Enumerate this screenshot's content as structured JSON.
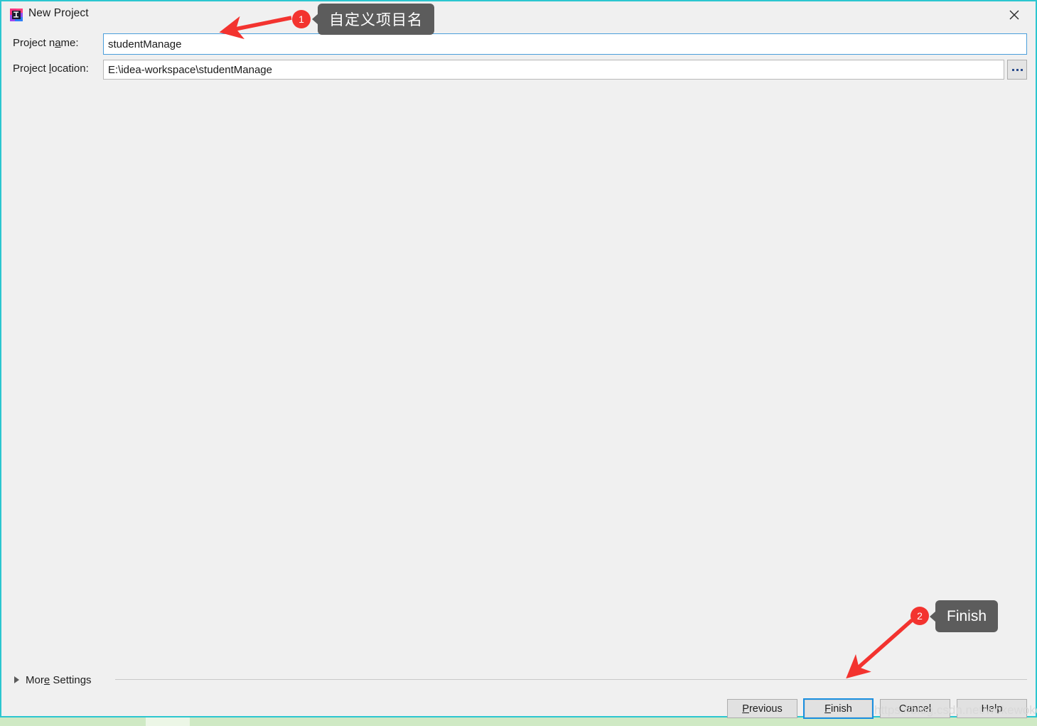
{
  "window": {
    "title": "New Project",
    "app_icon": "intellij-idea-icon",
    "close_icon": "close-icon",
    "border_color": "#2cc6d0"
  },
  "form": {
    "name_label_pre": "Project n",
    "name_label_mnemonic": "a",
    "name_label_post": "me:",
    "name_label_full": "Project name:",
    "name_value": "studentManage",
    "name_placeholder": "",
    "location_label_pre": "Project ",
    "location_label_mnemonic": "l",
    "location_label_post": "ocation:",
    "location_label_full": "Project location:",
    "location_value": "E:\\idea-workspace\\studentManage",
    "location_placeholder": "",
    "browse_button_label": "...",
    "browse_icon": "ellipsis-icon"
  },
  "more_settings": {
    "label_pre": "Mor",
    "label_mnemonic": "e",
    "label_post": " Settings",
    "label_full": "More Settings",
    "expand_icon": "chevron-right-icon",
    "expanded": false
  },
  "buttons": {
    "previous_pre": "",
    "previous_mnemonic": "P",
    "previous_post": "revious",
    "previous_label": "Previous",
    "finish_pre": "",
    "finish_mnemonic": "F",
    "finish_post": "inish",
    "finish_label": "Finish",
    "cancel_label": "Cancel",
    "help_label": "Help",
    "focused": "Finish",
    "focus_color": "#1a8fe0"
  },
  "annotations": [
    {
      "number": "1",
      "tooltip": "自定义项目名",
      "target": "project-name-input",
      "color": "#f3332f"
    },
    {
      "number": "2",
      "tooltip": "Finish",
      "target": "finish-button",
      "color": "#f3332f"
    }
  ],
  "watermark": {
    "text": "https://blog.csdn.net/wokewoke"
  }
}
